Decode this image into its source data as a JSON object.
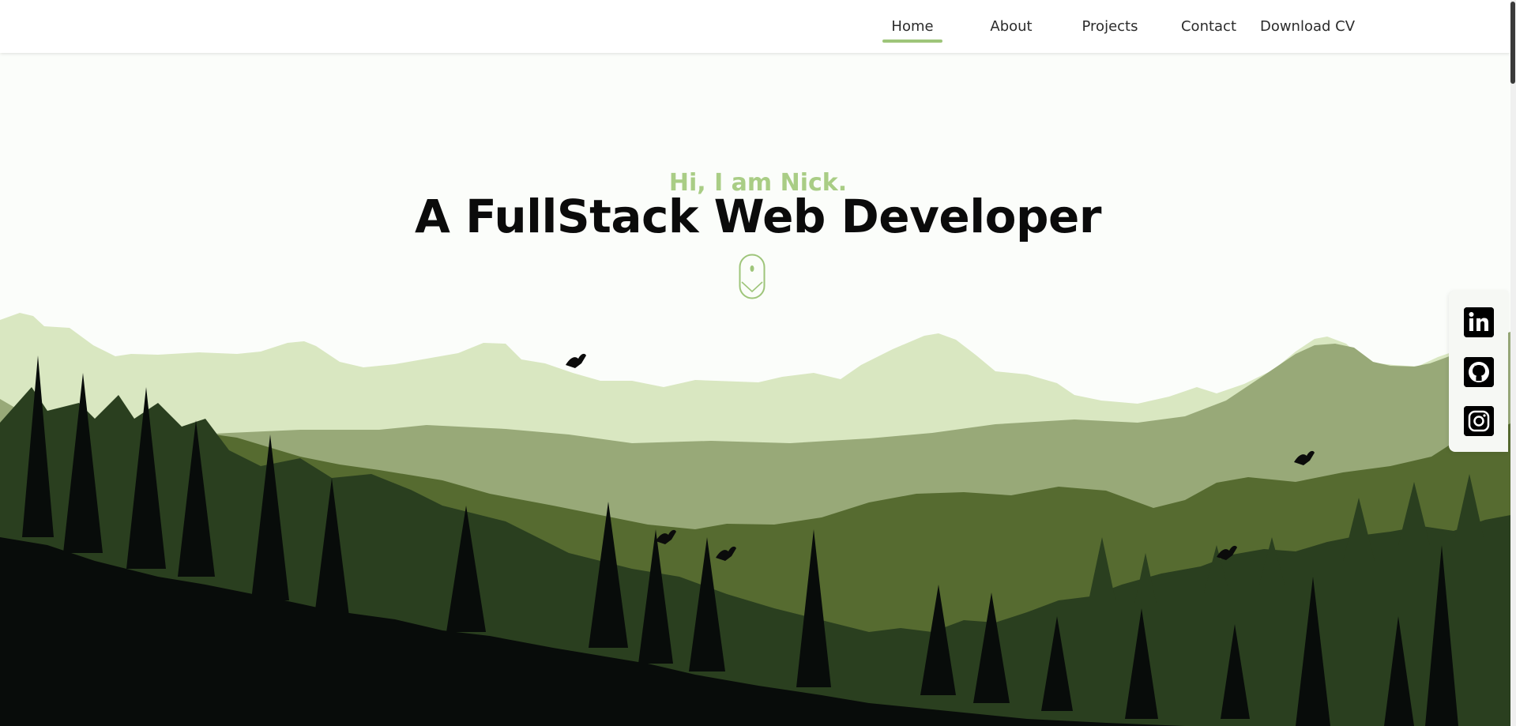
{
  "nav": {
    "items": [
      {
        "label": "Home",
        "active": true
      },
      {
        "label": "About"
      },
      {
        "label": "Projects"
      },
      {
        "label": "Contact"
      },
      {
        "label": "Download CV"
      }
    ]
  },
  "hero": {
    "greeting": "Hi, I am Nick.",
    "title": "A FullStack Web Developer"
  },
  "icons": {
    "scroll": "mouse-scroll-icon",
    "social": [
      "linkedin-icon",
      "github-icon",
      "instagram-icon"
    ]
  },
  "colors": {
    "accent": "#9ec57a",
    "greeting": "#a9cd85",
    "title": "#0b0b0b",
    "mountain_far": "#d9e7c1",
    "mountain_mid": "#98a978",
    "forest_far": "#566b30",
    "forest_mid": "#2a3f1f",
    "forest_near": "#080c0a"
  }
}
